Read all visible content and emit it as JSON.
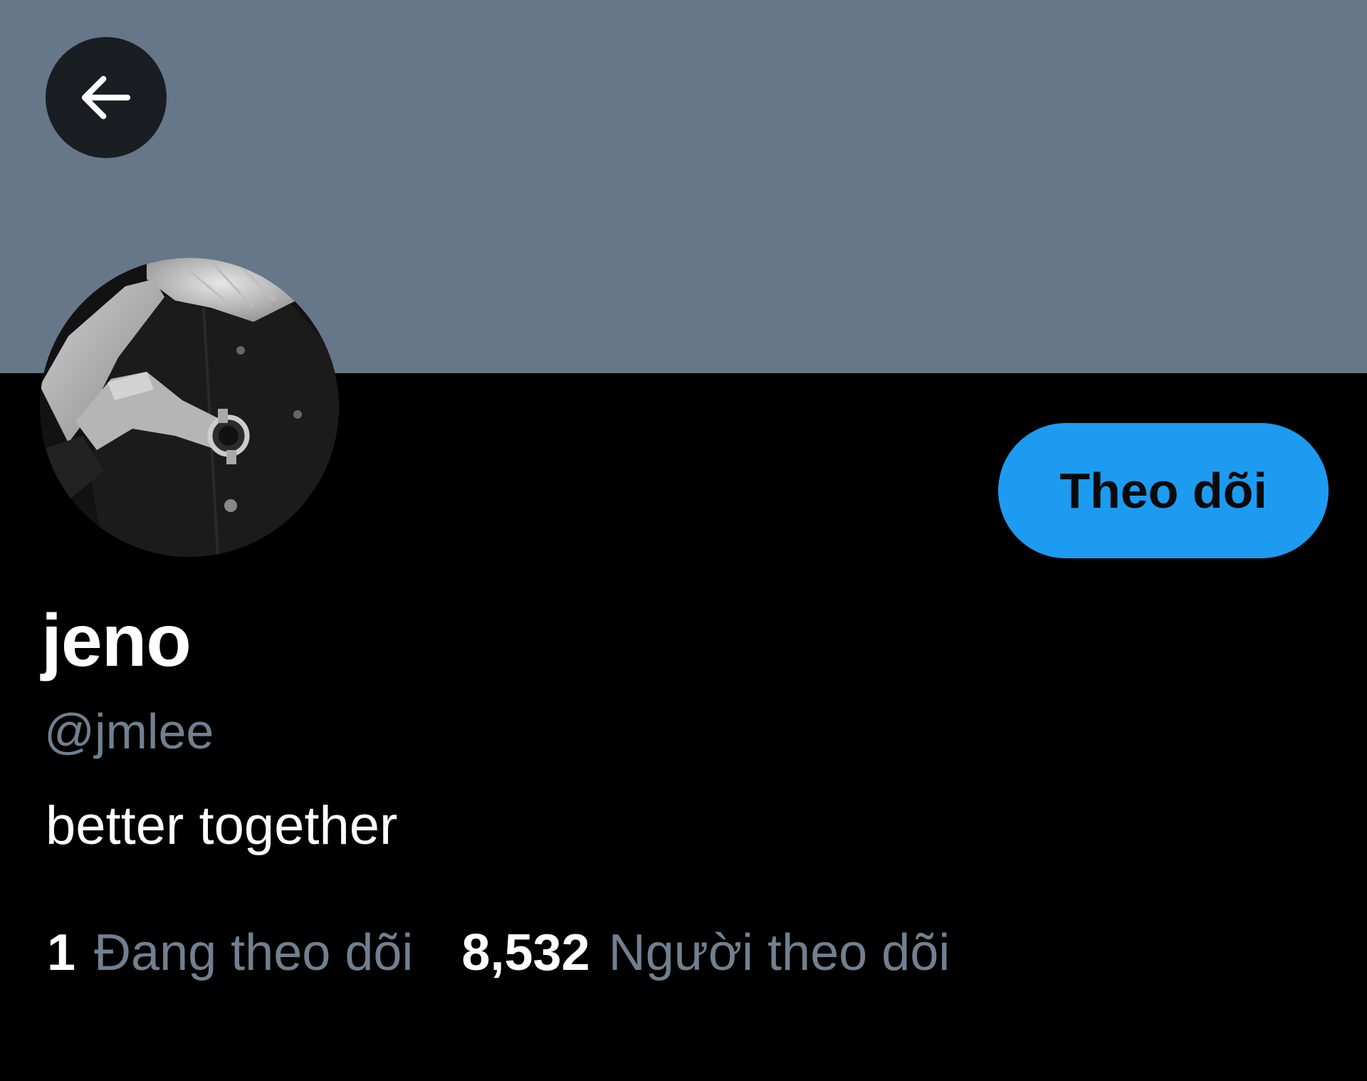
{
  "header": {
    "back_icon": "arrow-left-icon",
    "banner_color": "#66778a"
  },
  "profile": {
    "display_name": "jeno",
    "handle": "@jmlee",
    "bio": "better together",
    "follow_label": "Theo dõi",
    "accent_color": "#1d9bf0"
  },
  "stats": {
    "following_count": "1",
    "following_label": "Đang theo dõi",
    "followers_count": "8,532",
    "followers_label": "Người theo dõi"
  }
}
